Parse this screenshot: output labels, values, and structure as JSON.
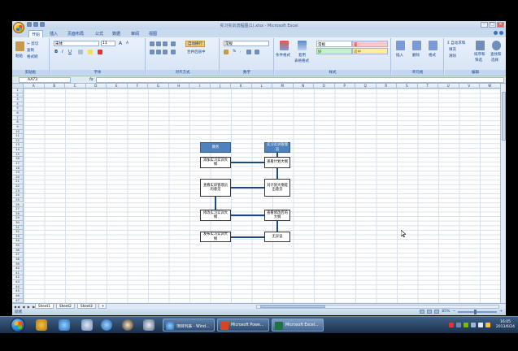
{
  "window": {
    "title": "实习实训流程图(1).xlsx - Microsoft Excel",
    "min": "–",
    "max": "□",
    "close": "×"
  },
  "tabs": [
    "开始",
    "插入",
    "页面布局",
    "公式",
    "数据",
    "审阅",
    "视图"
  ],
  "ribbon": {
    "clipboard": {
      "paste": "粘贴",
      "cut": "✂ 剪切",
      "copy": "复制",
      "format_painter": "格式刷",
      "label": "剪贴板"
    },
    "font": {
      "name": "宋体",
      "size": "11",
      "bold": "B",
      "italic": "I",
      "underline": "U",
      "grow": "A",
      "shrink": "A",
      "label": "字体"
    },
    "alignment": {
      "wrap": "自动换行",
      "merge": "合并后居中",
      "label": "对齐方式"
    },
    "number": {
      "format": "常规",
      "percent": "%",
      "comma": ",",
      "label": "数字"
    },
    "styles": {
      "conditional": "条件格式",
      "table": "套用",
      "table2": "表格格式",
      "normal": "常规",
      "bad": "差",
      "good": "好",
      "neutral": "适中",
      "label": "样式"
    },
    "cells": {
      "insert": "插入",
      "delete": "删除",
      "format": "格式",
      "label": "单元格"
    },
    "editing": {
      "autosum": "Σ 自动求和",
      "fill": "填充",
      "clear": "清除",
      "sort": "排序和",
      "sort2": "筛选",
      "find": "查找和",
      "find2": "选择",
      "label": "编辑"
    }
  },
  "formula_bar": {
    "name_box": "AA73",
    "fx": "fx",
    "value": ""
  },
  "columns": [
    "A",
    "B",
    "C",
    "D",
    "E",
    "F",
    "G",
    "H",
    "I",
    "J",
    "K",
    "L",
    "M",
    "N",
    "O",
    "P",
    "Q",
    "R",
    "S",
    "T",
    "U",
    "V",
    "W"
  ],
  "rows": [
    "1",
    "2",
    "3",
    "4",
    "5",
    "6",
    "7",
    "8",
    "9",
    "10",
    "11",
    "12",
    "13",
    "14",
    "15",
    "16",
    "17",
    "18",
    "19",
    "20",
    "21",
    "22",
    "23",
    "24",
    "25",
    "26",
    "27",
    "28",
    "29",
    "30",
    "31",
    "32",
    "33",
    "34",
    "35",
    "36",
    "37",
    "38",
    "39",
    "40",
    "41",
    "42",
    "43",
    "44",
    "45",
    "46",
    "47"
  ],
  "flowchart": {
    "left_header": "教务",
    "right_header": "实习实训管理员",
    "left_steps": [
      "添加实习实训大纲",
      "查看实训管理员的意见",
      "修改实习实训大纲",
      "发布实习实训大纲"
    ],
    "right_steps": [
      "查看计划大纲",
      "对计划大纲提出意见",
      "查看修改后的大纲",
      "无异议"
    ]
  },
  "sheets": [
    "Sheet1",
    "Sheet2",
    "Sheet3"
  ],
  "sheet_nav": "◀◀ ◀ ▶ ▶▶",
  "status": {
    "ready": "就绪",
    "zoom": "85%",
    "zoom_minus": "−",
    "zoom_plus": "+"
  },
  "taskbar": {
    "tasks": [
      "项目列表 - Wind...",
      "Microsoft Powe...",
      "Microsoft Excel..."
    ],
    "time": "16:05",
    "date": "2013/6/24"
  },
  "colors": {
    "accent": "#4f81bd",
    "ribbon": "#dfe8f5",
    "taskbar": "#1b2f48"
  }
}
